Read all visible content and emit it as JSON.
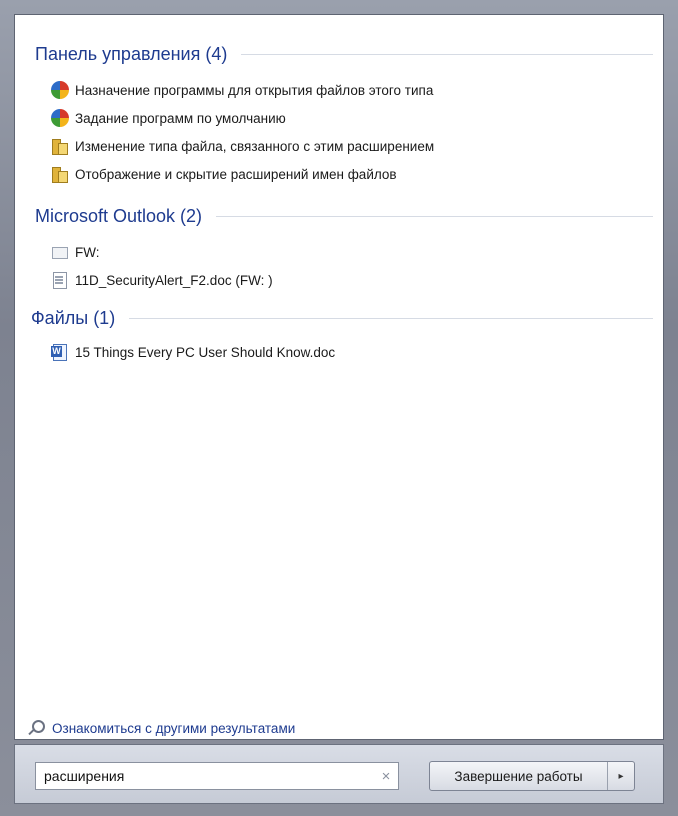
{
  "groups": [
    {
      "title": "Панель управления (4)",
      "items": [
        {
          "label": "Назначение программы для открытия файлов этого типа",
          "icon": "control-panel-icon"
        },
        {
          "label": "Задание программ по умолчанию",
          "icon": "control-panel-icon"
        },
        {
          "label": "Изменение типа файла, связанного с этим расширением",
          "icon": "folder-options-icon"
        },
        {
          "label": "Отображение и скрытие расширений имен файлов",
          "icon": "folder-options-icon"
        }
      ]
    },
    {
      "title": "Microsoft Outlook (2)",
      "items": [
        {
          "label": "FW:",
          "icon": "mail-icon"
        },
        {
          "label": "11D_SecurityAlert_F2.doc (FW: )",
          "icon": "document-icon"
        }
      ]
    },
    {
      "title": "Файлы (1)",
      "items": [
        {
          "label": "15 Things Every PC User Should Know.doc",
          "icon": "word-document-icon"
        }
      ]
    }
  ],
  "more_results": "Ознакомиться с другими результатами",
  "search": {
    "value": "расширения",
    "clear_glyph": "×"
  },
  "shutdown": {
    "label": "Завершение работы",
    "arrow_glyph": "▸"
  }
}
